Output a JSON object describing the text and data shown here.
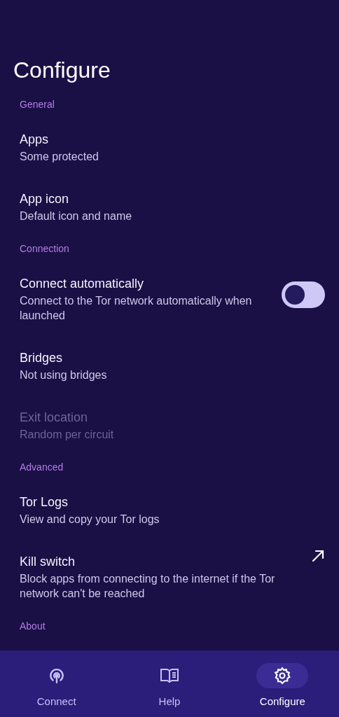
{
  "title": "Configure",
  "sections": [
    {
      "header": "General",
      "items": [
        {
          "kind": "nav",
          "title": "Apps",
          "subtitle": "Some protected",
          "disabled": false
        },
        {
          "kind": "nav",
          "title": "App icon",
          "subtitle": "Default icon and name",
          "disabled": false
        }
      ]
    },
    {
      "header": "Connection",
      "items": [
        {
          "kind": "toggle",
          "title": "Connect automatically",
          "subtitle": "Connect to the Tor network automatically when launched",
          "disabled": false,
          "on": false
        },
        {
          "kind": "nav",
          "title": "Bridges",
          "subtitle": "Not using bridges",
          "disabled": false
        },
        {
          "kind": "nav",
          "title": "Exit location",
          "subtitle": "Random per circuit",
          "disabled": true
        }
      ]
    },
    {
      "header": "Advanced",
      "items": [
        {
          "kind": "nav",
          "title": "Tor Logs",
          "subtitle": "View and copy your Tor logs",
          "disabled": false
        },
        {
          "kind": "external",
          "title": "Kill switch",
          "subtitle": "Block apps from connecting to the internet if the Tor network can't be reached",
          "disabled": false
        }
      ]
    },
    {
      "header": "About"
    }
  ],
  "bottom_nav": [
    {
      "kind": "connect",
      "label": "Connect",
      "selected": false
    },
    {
      "kind": "help",
      "label": "Help",
      "selected": false
    },
    {
      "kind": "configure",
      "label": "Configure",
      "selected": true
    }
  ]
}
